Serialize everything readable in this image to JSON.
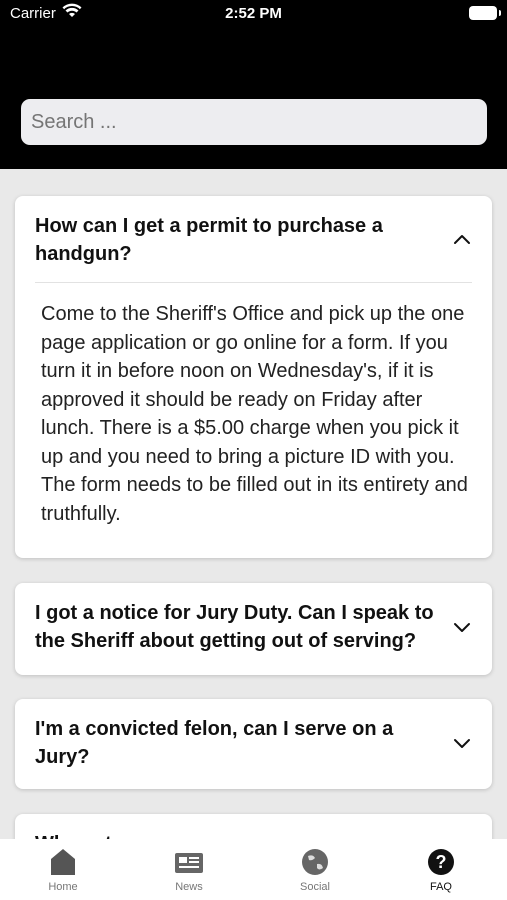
{
  "status_bar": {
    "carrier": "Carrier",
    "time": "2:52 PM"
  },
  "search": {
    "placeholder": "Search ..."
  },
  "faq": [
    {
      "question": "How can I get a permit to purchase a handgun?",
      "expanded": true,
      "answer": "Come to the Sheriff's Office and pick up the one page application or go online for a form.  If you turn it in before noon on Wednesday's, if it is approved it should be ready on Friday after lunch.  There is a $5.00 charge when you pick it up and you need to bring a picture ID with you.  The form needs to be filled out in its entirety and truthfully."
    },
    {
      "question": "I got a notice for Jury Duty. Can I speak to the Sheriff about getting out of serving?",
      "expanded": false
    },
    {
      "question": "I'm a convicted felon, can I serve on a Jury?",
      "expanded": false
    },
    {
      "question": "Wh... ...t ...",
      "expanded": false
    }
  ],
  "tab_bar": {
    "items": [
      {
        "label": "Home",
        "icon": "home-icon"
      },
      {
        "label": "News",
        "icon": "newspaper-icon"
      },
      {
        "label": "Social",
        "icon": "globe-icon"
      },
      {
        "label": "FAQ",
        "icon": "question-icon",
        "active": true
      }
    ]
  },
  "colors": {
    "header": "#000000",
    "background": "#e9e9e9",
    "card": "#ffffff"
  }
}
